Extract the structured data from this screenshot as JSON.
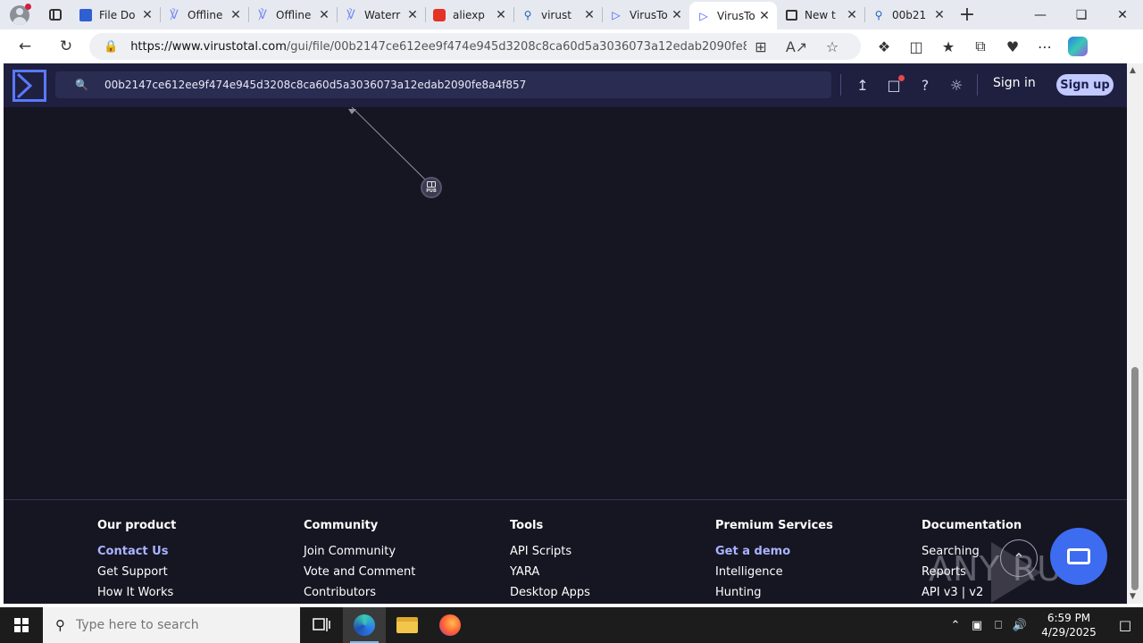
{
  "browser": {
    "tabs": [
      {
        "title": "File Do",
        "favicon": "file-doc-icon",
        "color": "#2f5fd0"
      },
      {
        "title": "Offline",
        "favicon": "offline-icon",
        "color": "#7a8cf0"
      },
      {
        "title": "Offline",
        "favicon": "offline-icon",
        "color": "#7a8cf0"
      },
      {
        "title": "Waterr",
        "favicon": "waterr-icon",
        "color": "#7a8cf0"
      },
      {
        "title": "aliexp",
        "favicon": "aliexpress-icon",
        "color": "#e43225"
      },
      {
        "title": "virust",
        "favicon": "search-icon",
        "color": "#1f5fbf"
      },
      {
        "title": "VirusTo",
        "favicon": "virustotal-icon",
        "color": "#394eff"
      },
      {
        "title": "VirusTo",
        "favicon": "virustotal-icon",
        "color": "#394eff",
        "active": true
      },
      {
        "title": "New t",
        "favicon": "newtab-icon",
        "color": "#333333"
      },
      {
        "title": "00b21",
        "favicon": "search-icon",
        "color": "#1f5fbf"
      }
    ],
    "url_domain": "https://www.virustotal.com",
    "url_path": "/gui/file/00b2147ce612ee9f474e945d3208c8ca60d5a3036073a12edab2090fe8a4f..."
  },
  "vt": {
    "search_value": "00b2147ce612ee9f474e945d3208c8ca60d5a3036073a12edab2090fe8a4f857",
    "sign_in": "Sign in",
    "sign_up": "Sign up",
    "graph_node_label": "PUB",
    "colors": {
      "header": "#1f2040",
      "background": "#161522",
      "accent": "#394eff",
      "signup_bg": "#c2c9ff",
      "highlight_link": "#a9b4ff"
    }
  },
  "footer": {
    "columns": [
      {
        "heading": "Our product",
        "links": [
          {
            "label": "Contact Us",
            "hl": true
          },
          {
            "label": "Get Support"
          },
          {
            "label": "How It Works"
          }
        ]
      },
      {
        "heading": "Community",
        "links": [
          {
            "label": "Join Community"
          },
          {
            "label": "Vote and Comment"
          },
          {
            "label": "Contributors"
          }
        ]
      },
      {
        "heading": "Tools",
        "links": [
          {
            "label": "API Scripts"
          },
          {
            "label": "YARA"
          },
          {
            "label": "Desktop Apps"
          }
        ]
      },
      {
        "heading": "Premium Services",
        "links": [
          {
            "label": "Get a demo",
            "hl": true
          },
          {
            "label": "Intelligence"
          },
          {
            "label": "Hunting"
          }
        ]
      },
      {
        "heading": "Documentation",
        "links": [
          {
            "label": "Searching"
          },
          {
            "label": "Reports"
          },
          {
            "label": "API v3 | v2"
          }
        ]
      }
    ]
  },
  "watermark": "ANY RUN",
  "taskbar": {
    "search_placeholder": "Type here to search",
    "time": "6:59 PM",
    "date": "4/29/2025"
  }
}
